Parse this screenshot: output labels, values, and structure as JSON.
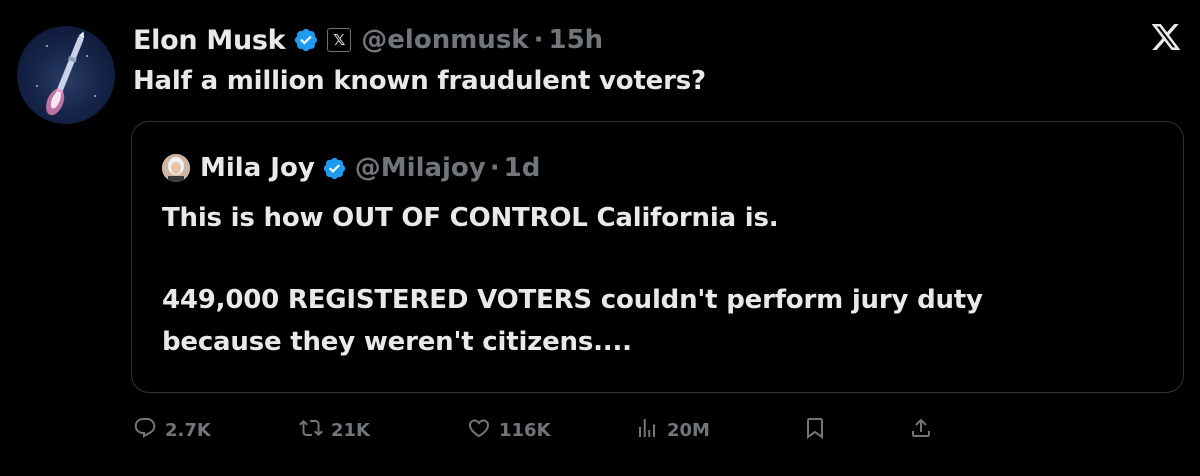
{
  "tweet": {
    "author_name": "Elon Musk",
    "affiliate_badge": "𝕏",
    "handle": "@elonmusk",
    "separator": "·",
    "time": "15h",
    "text": "Half a million known fraudulent voters?",
    "verified_color": "#1d9bf0"
  },
  "quote": {
    "author_name": "Mila Joy",
    "handle": "@Milajoy",
    "separator": "·",
    "time": "1d",
    "line1": "This is how OUT OF CONTROL California is.",
    "line2": "449,000 REGISTERED VOTERS couldn't perform jury duty",
    "line3": "because they weren't citizens...."
  },
  "actions": {
    "replies": "2.7K",
    "reposts": "21K",
    "likes": "116K",
    "views": "20M"
  },
  "icons": {
    "close": "x-logo-icon",
    "reply": "reply-icon",
    "repost": "repost-icon",
    "like": "heart-icon",
    "views": "views-icon",
    "bookmark": "bookmark-icon",
    "share": "share-icon"
  },
  "colors": {
    "background": "#000000",
    "text": "#e7e9ea",
    "muted": "#71767b",
    "border": "#2f3336"
  }
}
